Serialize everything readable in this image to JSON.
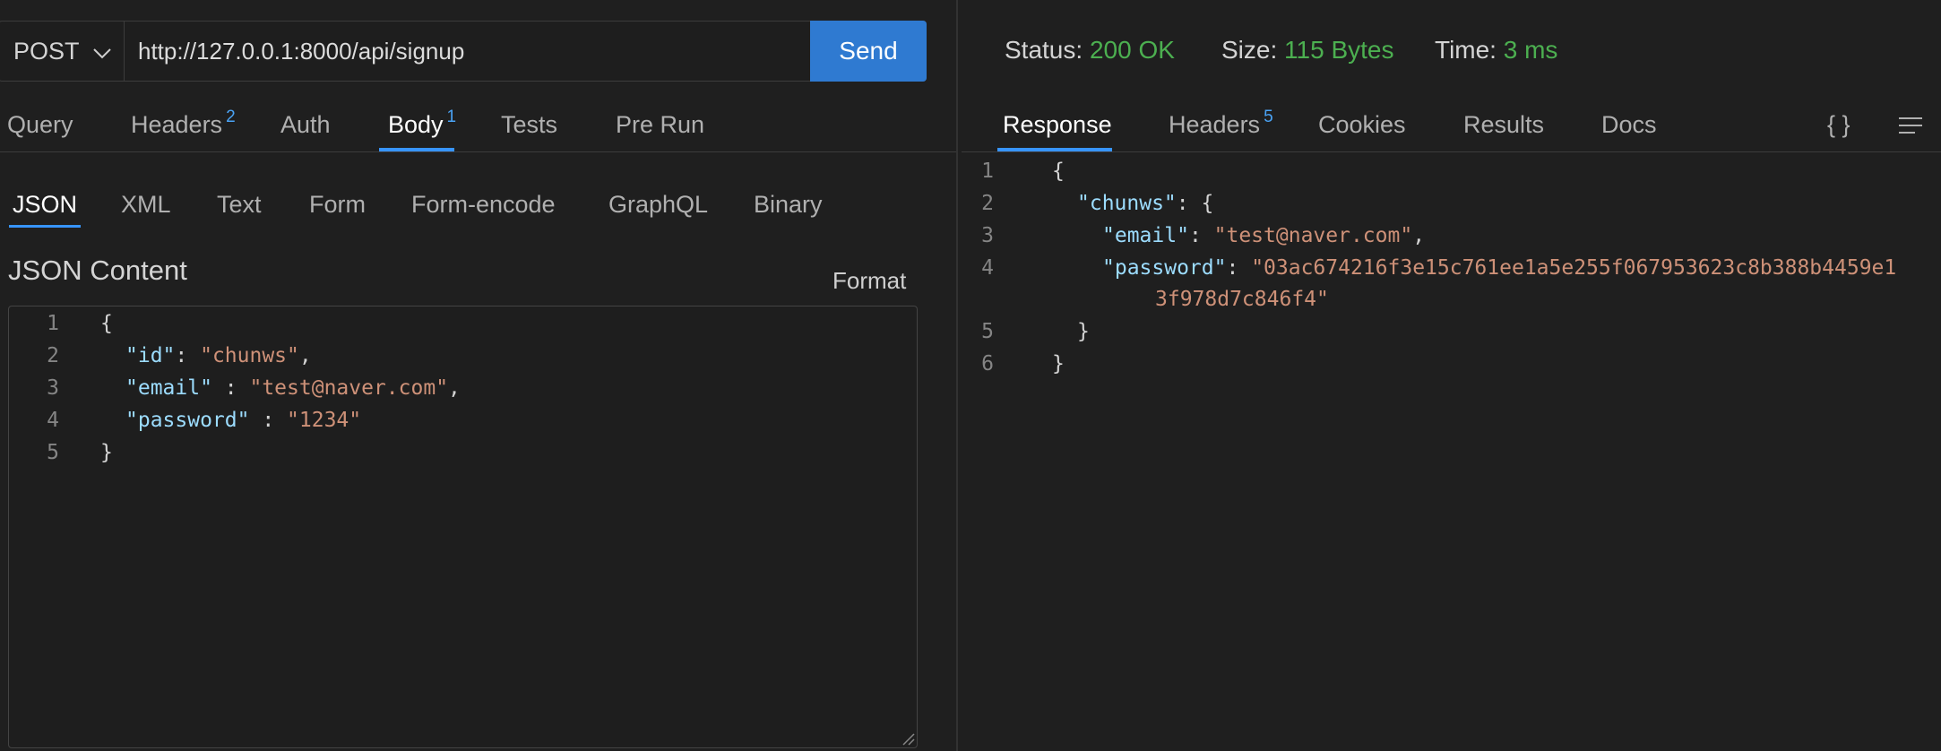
{
  "request": {
    "method": "POST",
    "url": "http://127.0.0.1:8000/api/signup",
    "send_label": "Send",
    "tabs": [
      {
        "label": "Query",
        "badge": ""
      },
      {
        "label": "Headers",
        "badge": "2"
      },
      {
        "label": "Auth",
        "badge": ""
      },
      {
        "label": "Body",
        "badge": "1"
      },
      {
        "label": "Tests",
        "badge": ""
      },
      {
        "label": "Pre Run",
        "badge": ""
      }
    ],
    "active_tab": "Body",
    "body_types": [
      "JSON",
      "XML",
      "Text",
      "Form",
      "Form-encode",
      "GraphQL",
      "Binary"
    ],
    "active_body_type": "JSON",
    "section_title": "JSON Content",
    "format_label": "Format",
    "line_numbers": [
      "1",
      "2",
      "3",
      "4",
      "5"
    ],
    "code": {
      "l1_open": "{",
      "l2_key": "\"id\"",
      "l2_sep": ": ",
      "l2_val": "\"chunws\"",
      "l2_end": ",",
      "l3_key": "\"email\"",
      "l3_sep": " : ",
      "l3_val": "\"test@naver.com\"",
      "l3_end": ",",
      "l4_key": "\"password\"",
      "l4_sep": " : ",
      "l4_val": "\"1234\"",
      "l5_close": "}"
    }
  },
  "response": {
    "status_label": "Status:",
    "status_value": "200 OK",
    "size_label": "Size:",
    "size_value": "115 Bytes",
    "time_label": "Time:",
    "time_value": "3 ms",
    "tabs": [
      {
        "label": "Response",
        "badge": ""
      },
      {
        "label": "Headers",
        "badge": "5"
      },
      {
        "label": "Cookies",
        "badge": ""
      },
      {
        "label": "Results",
        "badge": ""
      },
      {
        "label": "Docs",
        "badge": ""
      }
    ],
    "active_tab": "Response",
    "braces_icon_text": "{ }",
    "line_numbers": [
      "1",
      "2",
      "3",
      "4",
      "5",
      "6"
    ],
    "code": {
      "l1_open": "{",
      "l2_key": "\"chunws\"",
      "l2_rest": ": {",
      "l3_key": "\"email\"",
      "l3_sep": ": ",
      "l3_val": "\"test@naver.com\"",
      "l3_end": ",",
      "l4_key": "\"password\"",
      "l4_sep": ": ",
      "l4_val_a": "\"03ac674216f3e15c761ee1a5e255f067953623c8b388b4459e1",
      "l4_val_b": "3f978d7c846f4\"",
      "l5_close": "}",
      "l6_close": "}"
    }
  },
  "colors": {
    "background": "#1f1f1f",
    "accent": "#3794ff",
    "send_button": "#2f7ad1",
    "status_ok": "#4caf50",
    "json_key": "#9cdcfe",
    "json_string": "#ce9178"
  }
}
